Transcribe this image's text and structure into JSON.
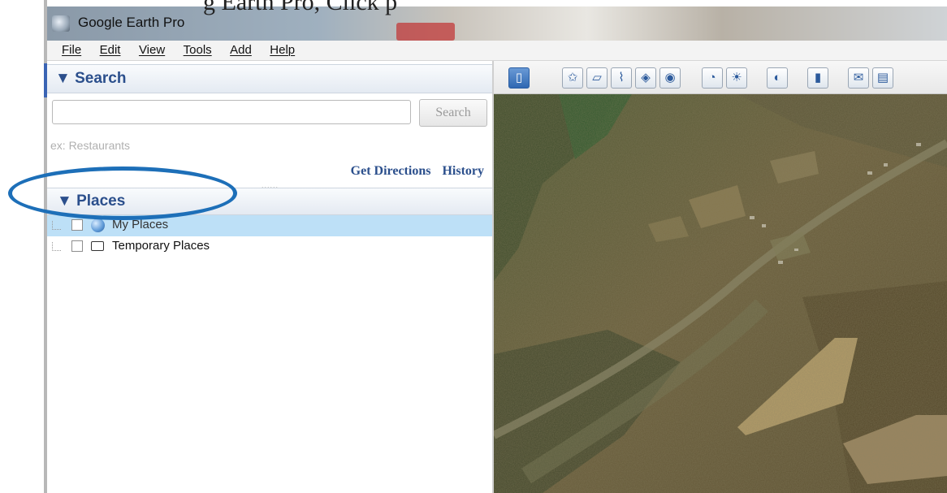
{
  "caption": {
    "partial_text": "g Earth Pro, Click p"
  },
  "window": {
    "title": "Google Earth Pro"
  },
  "menubar": {
    "items": [
      {
        "label": "File"
      },
      {
        "label": "Edit"
      },
      {
        "label": "View"
      },
      {
        "label": "Tools"
      },
      {
        "label": "Add"
      },
      {
        "label": "Help"
      }
    ]
  },
  "search_panel": {
    "header": "▼ Search",
    "input_value": "",
    "input_placeholder": "",
    "button_label": "Search",
    "hint": "ex: Restaurants",
    "links": {
      "directions": "Get Directions",
      "history": "History"
    },
    "splitter": "......"
  },
  "places_panel": {
    "header": "▼ Places",
    "items": [
      {
        "label": "My Places",
        "icon": "globe-icon",
        "selected": true
      },
      {
        "label": "Temporary Places",
        "icon": "folder-icon",
        "selected": false
      }
    ]
  },
  "toolbar": {
    "buttons": [
      {
        "name": "sidebar-toggle",
        "glyph": "▯"
      },
      {
        "name": "add-placemark",
        "glyph": "✩"
      },
      {
        "name": "add-polygon",
        "glyph": "▱"
      },
      {
        "name": "add-path",
        "glyph": "⌇"
      },
      {
        "name": "add-image-overlay",
        "glyph": "◈"
      },
      {
        "name": "record-tour",
        "glyph": "◉"
      },
      {
        "name": "historical-imagery",
        "glyph": "◔"
      },
      {
        "name": "sunlight",
        "glyph": "☀"
      },
      {
        "name": "switch-planet",
        "glyph": "◐"
      },
      {
        "name": "ruler",
        "glyph": "▮"
      },
      {
        "name": "email",
        "glyph": "✉"
      },
      {
        "name": "print",
        "glyph": "▤"
      }
    ]
  },
  "colors": {
    "panel_header_text": "#2b4f8c",
    "selection": "#bde0f7",
    "annotation": "#1d6fb8"
  }
}
